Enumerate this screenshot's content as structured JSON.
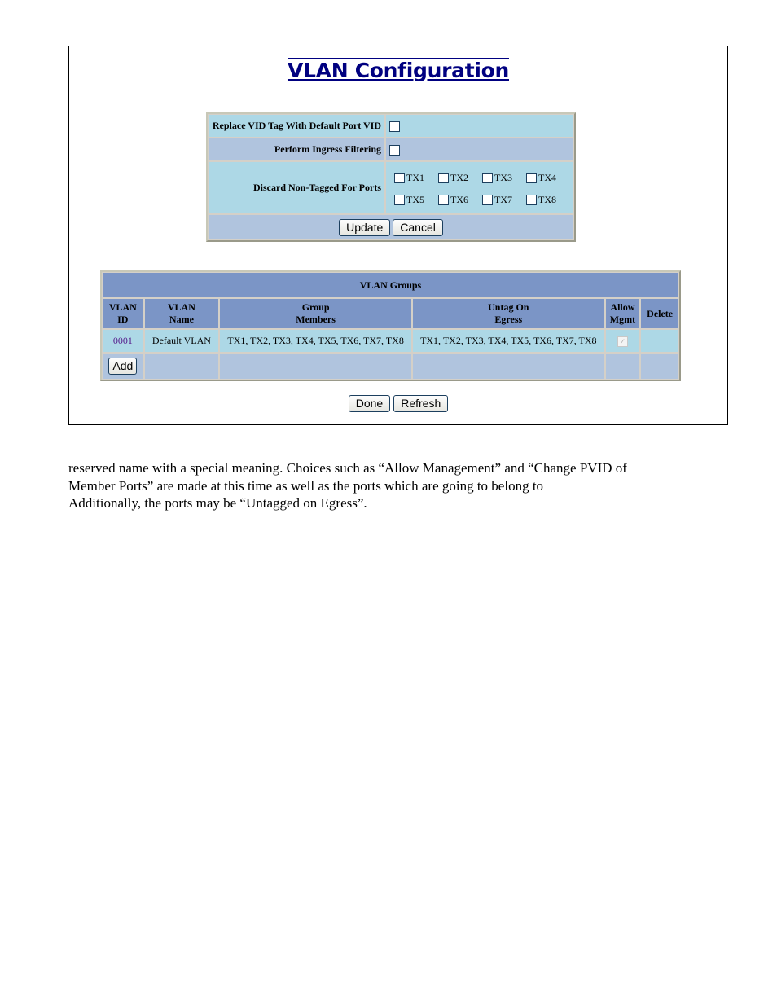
{
  "page": {
    "title": "VLAN Configuration"
  },
  "config": {
    "rows": [
      {
        "label": "Replace VID Tag With Default Port VID",
        "checked": false
      },
      {
        "label": "Perform Ingress Filtering",
        "checked": false
      },
      {
        "label": "Discard Non-Tagged For Ports"
      }
    ],
    "ports": [
      {
        "label": "TX1",
        "checked": false
      },
      {
        "label": "TX2",
        "checked": false
      },
      {
        "label": "TX3",
        "checked": false
      },
      {
        "label": "TX4",
        "checked": false
      },
      {
        "label": "TX5",
        "checked": false
      },
      {
        "label": "TX6",
        "checked": false
      },
      {
        "label": "TX7",
        "checked": false
      },
      {
        "label": "TX8",
        "checked": false
      }
    ],
    "update_label": "Update",
    "cancel_label": "Cancel"
  },
  "groups": {
    "title": "VLAN Groups",
    "columns": {
      "vlan_id": [
        "VLAN",
        "ID"
      ],
      "vlan_name": [
        "VLAN",
        "Name"
      ],
      "group_members": [
        "Group",
        "Members"
      ],
      "untag_on_egress": [
        "Untag On",
        "Egress"
      ],
      "allow_mgmt": [
        "Allow",
        "Mgmt"
      ],
      "delete": "Delete"
    },
    "rows": [
      {
        "vlan_id": "0001",
        "vlan_name": "Default VLAN",
        "group_members": "TX1, TX2, TX3, TX4, TX5, TX6, TX7, TX8",
        "untag_on_egress": "TX1, TX2, TX3, TX4, TX5, TX6, TX7, TX8",
        "allow_mgmt": true
      }
    ],
    "add_label": "Add"
  },
  "footer": {
    "done_label": "Done",
    "refresh_label": "Refresh"
  },
  "document": {
    "lines": [
      "reserved name with a special meaning. Choices such as “Allow Management” and “Change PVID of",
      "Member Ports” are made at this time as well as the ports which are going to belong to",
      "Additionally, the ports may be “Untagged on Egress”."
    ]
  },
  "colors": {
    "title": "#000080",
    "row_light": "#add8e6",
    "row_gray": "#b0c4de",
    "header": "#7b95c6",
    "link_visited": "#551a8b"
  }
}
